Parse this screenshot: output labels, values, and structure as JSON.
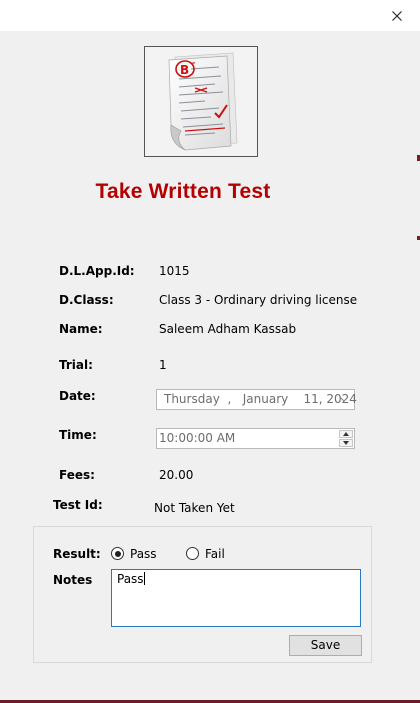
{
  "window": {
    "close_icon": "close-icon"
  },
  "form": {
    "title": "Take Written Test",
    "image_icon": "written-test-paper-icon",
    "title_color": "#b40000"
  },
  "fields": {
    "app_id": {
      "label": "D.L.App.Id:",
      "value": "1015"
    },
    "license_class": {
      "label": "D.Class:",
      "value": "Class 3 - Ordinary driving license"
    },
    "name": {
      "label": "Name:",
      "value": "Saleem Adham Kassab"
    },
    "trial": {
      "label": "Trial:",
      "value": "1"
    },
    "date": {
      "label": "Date:",
      "weekday": "Thursday",
      "sep": ",",
      "month": "January",
      "day_year": "11, 2024"
    },
    "time": {
      "label": "Time:",
      "value": "10:00:00 AM"
    },
    "fees": {
      "label": "Fees:",
      "value": "20.00"
    },
    "test_id": {
      "label": "Test Id:",
      "value": "Not Taken Yet"
    }
  },
  "result": {
    "label": "Result:",
    "options": [
      "Pass",
      "Fail"
    ],
    "selected": "Pass"
  },
  "notes": {
    "label": "Notes",
    "value": "Pass"
  },
  "actions": {
    "save_label": "Save"
  },
  "colors": {
    "accent_border": "#2a78c3",
    "window_edge": "#6d1b26"
  }
}
